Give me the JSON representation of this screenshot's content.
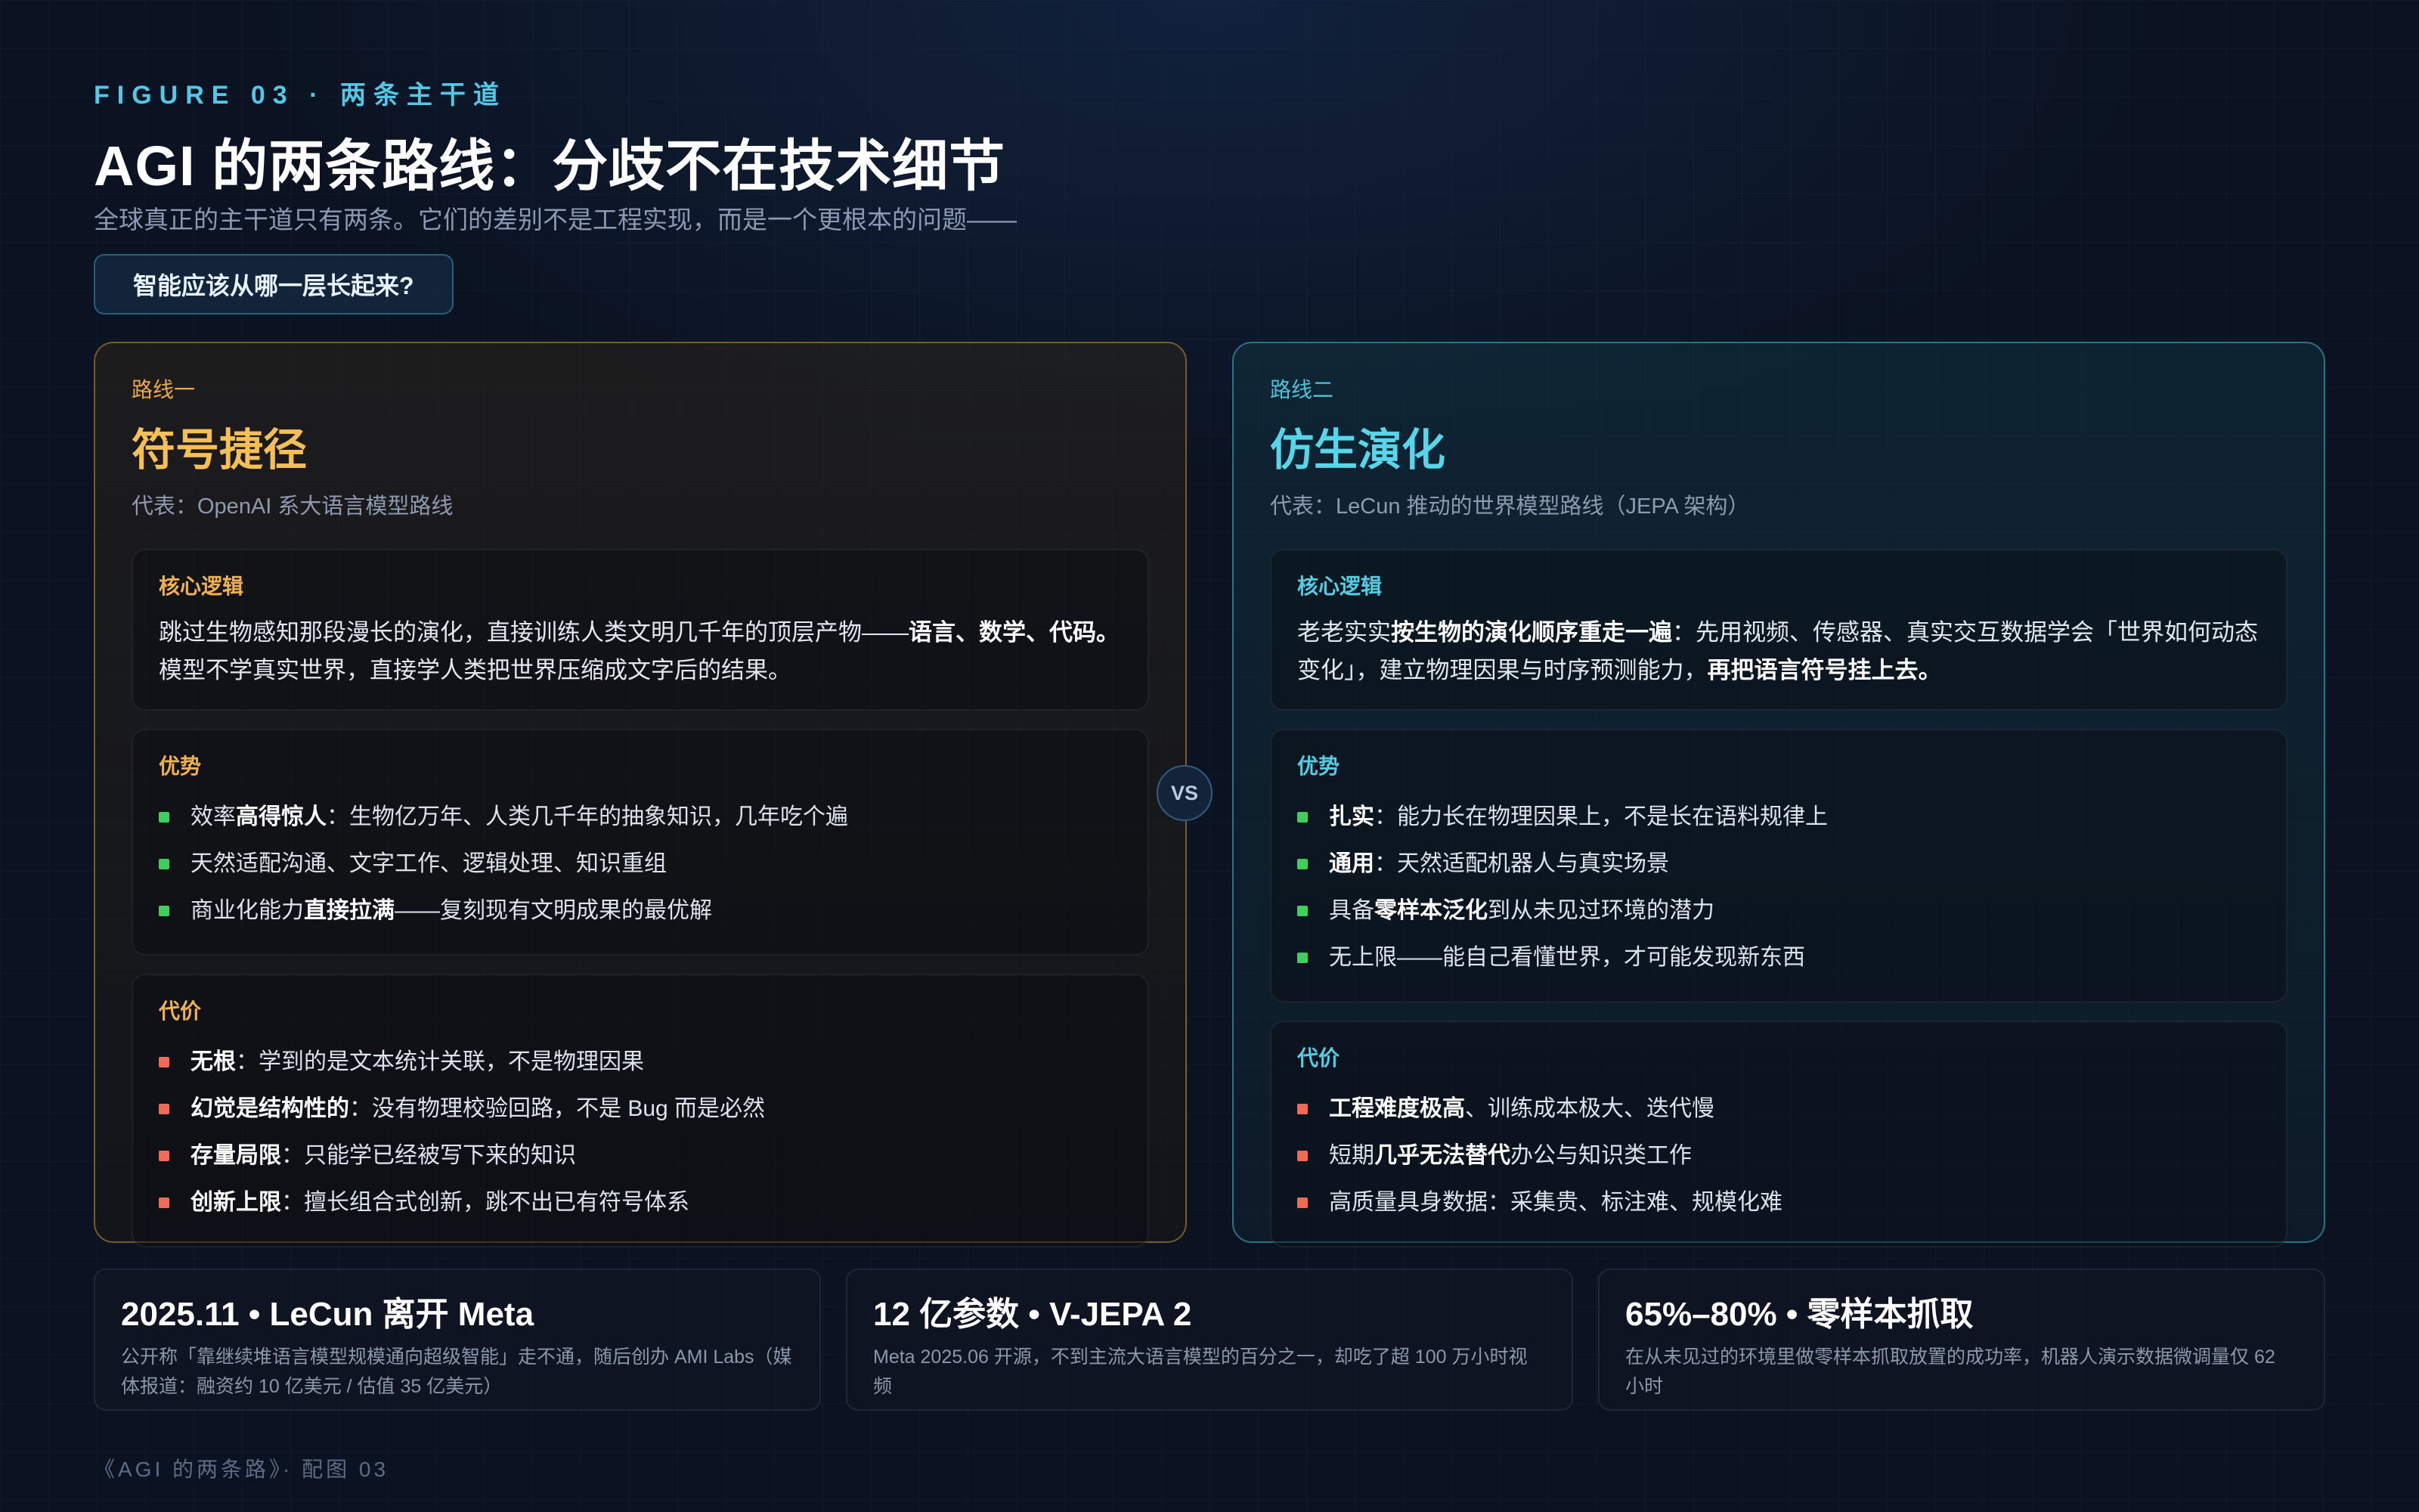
{
  "header": {
    "eyebrow": "FIGURE 03 · 两条主干道",
    "title": "AGI 的两条路线：分歧不在技术细节",
    "subtitle": "全球真正的主干道只有两条。它们的差别不是工程实现，而是一个更根本的问题——",
    "question": "智能应该从哪一层长起来?"
  },
  "routes": [
    {
      "route_label": "路线一",
      "name": "符号捷径",
      "representative": "代表：OpenAI 系大语言模型路线",
      "core_heading": "核心逻辑",
      "core_text": [
        {
          "t": "跳过生物感知那段漫长的演化，直接训练人类文明几千年的顶层产物——",
          "b": false
        },
        {
          "t": "语言、数学、代码。",
          "b": true
        },
        {
          "t": "模型不学真实世界，直接学人类把世界压缩成文字后的结果。",
          "b": false
        }
      ],
      "pros_heading": "优势",
      "pros": [
        [
          {
            "t": "效率",
            "b": false
          },
          {
            "t": "高得惊人",
            "b": true
          },
          {
            "t": "：生物亿万年、人类几千年的抽象知识，几年吃个遍",
            "b": false
          }
        ],
        [
          {
            "t": "天然适配沟通、文字工作、逻辑处理、知识重组",
            "b": false
          }
        ],
        [
          {
            "t": "商业化能力",
            "b": false
          },
          {
            "t": "直接拉满",
            "b": true
          },
          {
            "t": "——复刻现有文明成果的最优解",
            "b": false
          }
        ]
      ],
      "cons_heading": "代价",
      "cons": [
        [
          {
            "t": "无根",
            "b": true
          },
          {
            "t": "：学到的是文本统计关联，不是物理因果",
            "b": false
          }
        ],
        [
          {
            "t": "幻觉是结构性的",
            "b": true
          },
          {
            "t": "：没有物理校验回路，不是 Bug 而是必然",
            "b": false
          }
        ],
        [
          {
            "t": "存量局限",
            "b": true
          },
          {
            "t": "：只能学已经被写下来的知识",
            "b": false
          }
        ],
        [
          {
            "t": "创新上限",
            "b": true
          },
          {
            "t": "：擅长组合式创新，跳不出已有符号体系",
            "b": false
          }
        ]
      ]
    },
    {
      "route_label": "路线二",
      "name": "仿生演化",
      "representative": "代表：LeCun 推动的世界模型路线（JEPA 架构）",
      "core_heading": "核心逻辑",
      "core_text": [
        {
          "t": "老老实实",
          "b": false
        },
        {
          "t": "按生物的演化顺序重走一遍",
          "b": true
        },
        {
          "t": "：先用视频、传感器、真实交互数据学会「世界如何动态变化」，建立物理因果与时序预测能力，",
          "b": false
        },
        {
          "t": "再把语言符号挂上去。",
          "b": true
        }
      ],
      "pros_heading": "优势",
      "pros": [
        [
          {
            "t": "扎实",
            "b": true
          },
          {
            "t": "：能力长在物理因果上，不是长在语料规律上",
            "b": false
          }
        ],
        [
          {
            "t": "通用",
            "b": true
          },
          {
            "t": "：天然适配机器人与真实场景",
            "b": false
          }
        ],
        [
          {
            "t": "具备",
            "b": false
          },
          {
            "t": "零样本泛化",
            "b": true
          },
          {
            "t": "到从未见过环境的潜力",
            "b": false
          }
        ],
        [
          {
            "t": "无上限——能自己看懂世界，才可能发现新东西",
            "b": false
          }
        ]
      ],
      "cons_heading": "代价",
      "cons": [
        [
          {
            "t": "工程难度极高",
            "b": true
          },
          {
            "t": "、训练成本极大、迭代慢",
            "b": false
          }
        ],
        [
          {
            "t": "短期",
            "b": false
          },
          {
            "t": "几乎无法替代",
            "b": true
          },
          {
            "t": "办公与知识类工作",
            "b": false
          }
        ],
        [
          {
            "t": "高质量具身数据：采集贵、标注难、规模化难",
            "b": false
          }
        ]
      ]
    }
  ],
  "vs_label": "VS",
  "facts": [
    {
      "title": "2025.11 • LeCun 离开 Meta",
      "desc": "公开称「靠继续堆语言模型规模通向超级智能」走不通，随后创办 AMI Labs（媒体报道：融资约 10 亿美元 / 估值 35 亿美元）"
    },
    {
      "title": "12 亿参数 • V-JEPA 2",
      "desc": "Meta 2025.06 开源，不到主流大语言模型的百分之一，却吃了超 100 万小时视频"
    },
    {
      "title": "65%–80% • 零样本抓取",
      "desc": "在从未见过的环境里做零样本抓取放置的成功率，机器人演示数据微调量仅 62 小时"
    }
  ],
  "footer": "《AGI 的两条路》· 配图 03",
  "colors": {
    "route1_accent": "#f6bf55",
    "route2_accent": "#55d6ea",
    "pro_dot": "#3ecf5c",
    "con_dot": "#f06b56",
    "eyebrow": "#53c7e6"
  }
}
